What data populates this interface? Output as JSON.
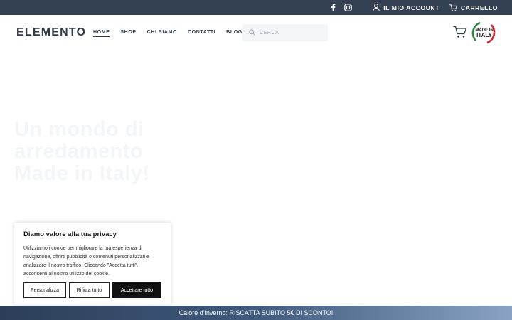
{
  "topbar": {
    "account_label": "IL MIO ACCOUNT",
    "cart_label": "CARRELLO",
    "social": [
      "facebook-icon",
      "instagram-icon"
    ]
  },
  "header": {
    "logo": "ELEMENTO",
    "nav": [
      {
        "label": "HOME",
        "active": true
      },
      {
        "label": "SHOP",
        "active": false
      },
      {
        "label": "CHI SIAMO",
        "active": false
      },
      {
        "label": "CONTATTI",
        "active": false
      },
      {
        "label": "BLOG",
        "active": false
      }
    ],
    "search_placeholder": "CERCA",
    "badge_text": "MADE IN ITALY"
  },
  "hero": {
    "heading": "Un mondo di arredamento Made in Italy!"
  },
  "cookie": {
    "title": "Diamo valore alla tua privacy",
    "text": "Utilizziamo i cookie per migliorare la tua esperienza di navigazione, offrirti pubblicità o contenuti personalizzati e analizzare il nostro traffico. Cliccando \"Accetta tutti\", acconsenti al nostro utilizzo dei cookie.",
    "customize_label": "Personalizza",
    "reject_label": "Rifiuta tutto",
    "accept_label": "Accettare tutto"
  },
  "promo": {
    "text": "Calore d'Inverno: RISCATTA SUBITO 5€ DI SCONTO!"
  },
  "colors": {
    "topbar": "#344152",
    "accent_text": "#2f3a48",
    "badge_green": "#2e8b3e",
    "badge_red": "#d3242b"
  }
}
